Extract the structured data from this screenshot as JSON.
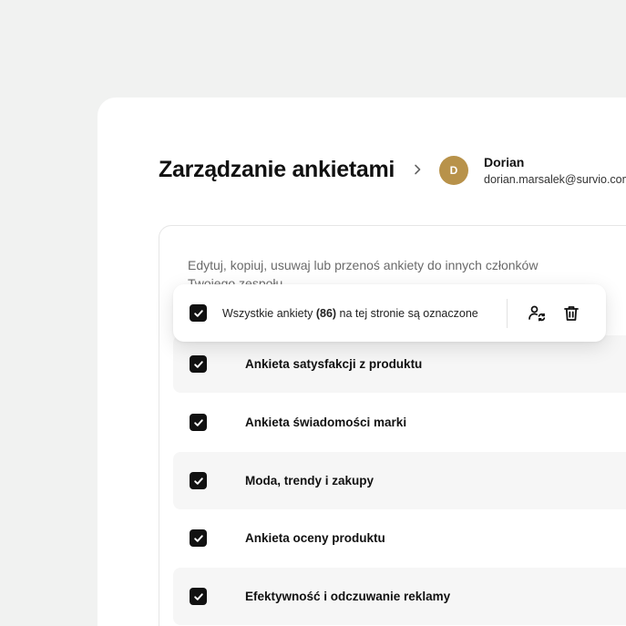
{
  "header": {
    "title": "Zarządzanie ankietami",
    "user": {
      "initial": "D",
      "name": "Dorian",
      "email": "dorian.marsalek@survio.com",
      "avatar_color": "#b8924a"
    }
  },
  "panel": {
    "description": "Edytuj, kopiuj, usuwaj lub przenoś ankiety do innych członków Twojego zespołu"
  },
  "selection_bar": {
    "text_before": "Wszystkie ankiety",
    "count": "(86)",
    "text_after": "na tej stronie są oznaczone",
    "checked": true,
    "actions": [
      "transfer-user-icon",
      "trash-icon"
    ]
  },
  "surveys": [
    {
      "title": "Ankieta satysfakcji z produktu",
      "checked": true
    },
    {
      "title": "Ankieta świadomości marki",
      "checked": true
    },
    {
      "title": "Moda, trendy i zakupy",
      "checked": true
    },
    {
      "title": "Ankieta oceny produktu",
      "checked": true
    },
    {
      "title": "Efektywność i odczuwanie reklamy",
      "checked": true
    }
  ],
  "colors": {
    "background": "#f1f2f1",
    "card": "#ffffff",
    "row_shade": "#f6f6f6",
    "checkbox": "#111111",
    "text_muted": "#6a6a6a"
  }
}
